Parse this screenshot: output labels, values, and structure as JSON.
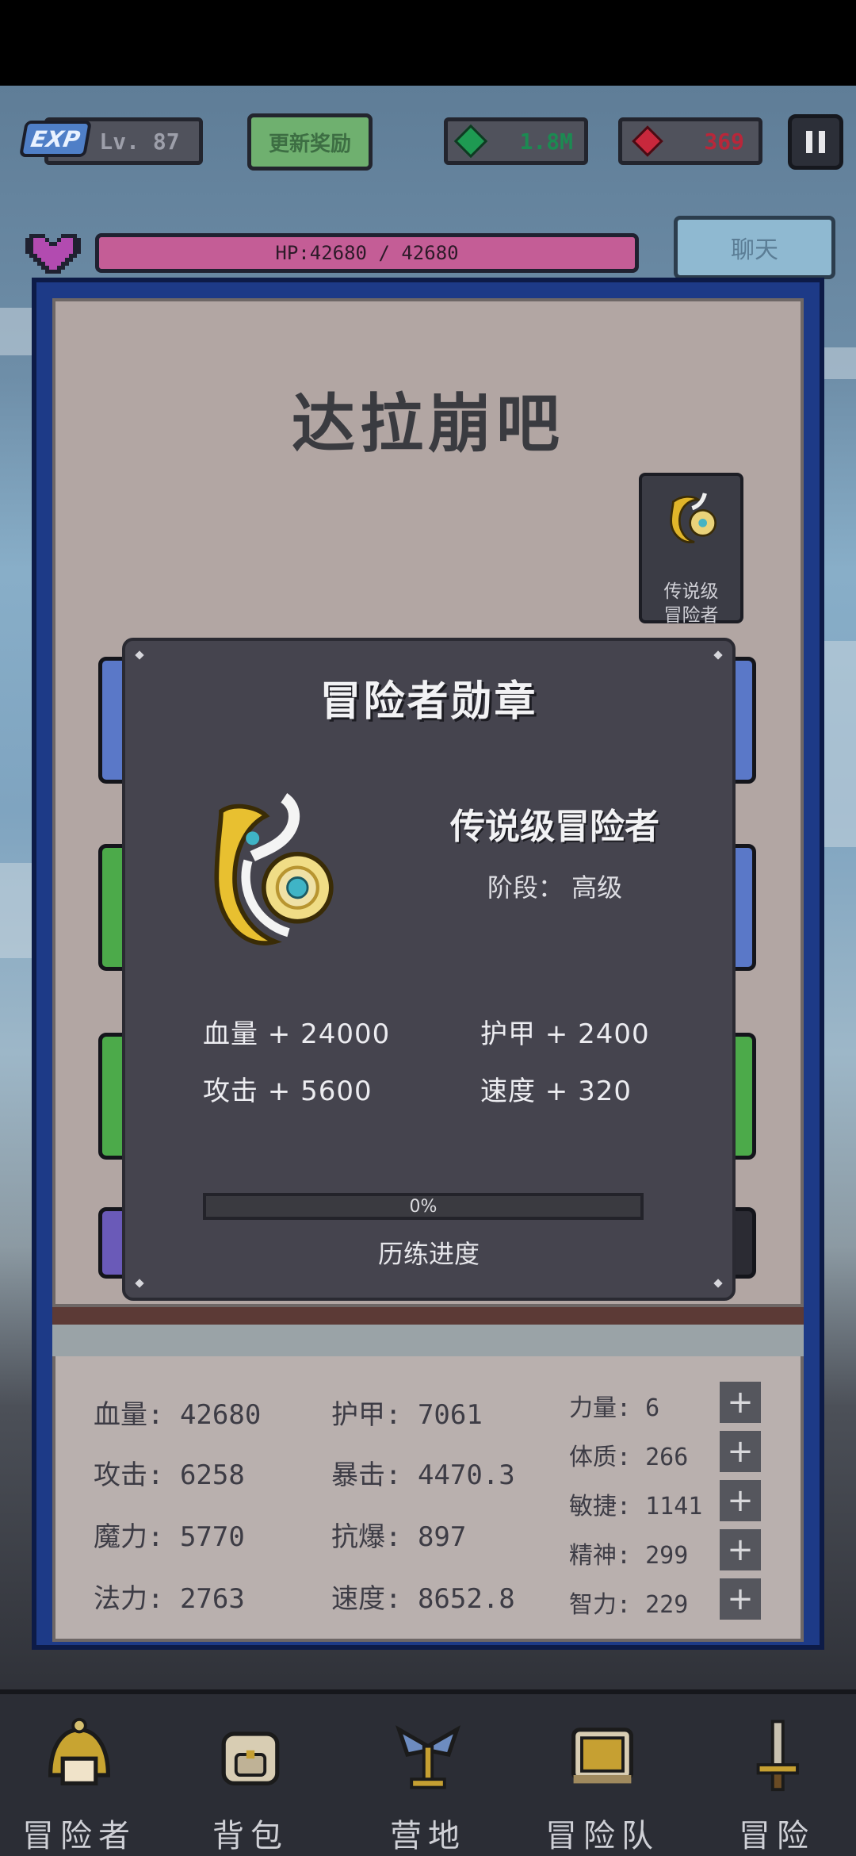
{
  "hud": {
    "exp_badge": "EXP",
    "level": "Lv. 87",
    "update_reward": "更新奖励",
    "gems": "1.8M",
    "rubies": "369",
    "hp_text": "HP:42680 / 42680",
    "chat": "聊天"
  },
  "panel": {
    "title": "达拉崩吧",
    "badge_label_line1": "传说级",
    "badge_label_line2": "冒险者"
  },
  "modal": {
    "title": "冒险者勋章",
    "medal_name": "传说级冒险者",
    "stage_label": "阶段：",
    "stage_value": "高级",
    "bonuses": {
      "hp": "血量 + 24000",
      "armor": "护甲 + 2400",
      "attack": "攻击 + 5600",
      "speed": "速度 + 320"
    },
    "progress_text": "0%",
    "progress_value": 0,
    "progress_label": "历练进度"
  },
  "stats": {
    "hp": "血量: 42680",
    "armor": "护甲: 7061",
    "attack": "攻击: 6258",
    "crit": "暴击: 4470.3",
    "magic": "魔力: 5770",
    "anti_crit": "抗爆: 897",
    "mana": "法力: 2763",
    "speed": "速度: 8652.8",
    "strength": "力量: 6",
    "constitution": "体质: 266",
    "agility": "敏捷: 1141",
    "spirit": "精神: 299",
    "intellect": "智力: 229",
    "plus": "+"
  },
  "nav": [
    {
      "label": "冒险者",
      "icon": "adventurer-helmet-icon"
    },
    {
      "label": "背包",
      "icon": "backpack-icon"
    },
    {
      "label": "营地",
      "icon": "camp-banner-icon"
    },
    {
      "label": "冒险队",
      "icon": "guild-book-icon"
    },
    {
      "label": "冒险",
      "icon": "sword-icon"
    }
  ],
  "colors": {
    "frame": "#1d3a87",
    "modal": "#45444e",
    "hp_bar": "#c45d96",
    "gem": "#1e9a52",
    "ruby": "#c8283c"
  }
}
